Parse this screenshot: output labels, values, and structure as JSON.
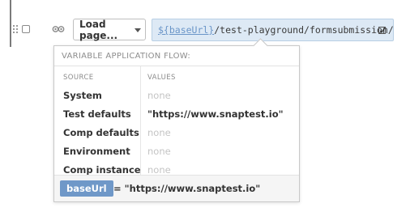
{
  "step": {
    "action_label": "Load page...",
    "url_variable": "${baseUrl}",
    "url_path": "/test-playground/formsubmission/"
  },
  "popover": {
    "title": "VARIABLE APPLICATION FLOW:",
    "columns": {
      "source": "SOURCE",
      "values": "VALUES"
    },
    "rows": [
      {
        "source": "System",
        "value": "none",
        "set": false
      },
      {
        "source": "Test defaults",
        "value": "\"https://www.snaptest.io\"",
        "set": true
      },
      {
        "source": "Comp defaults",
        "value": "none",
        "set": false
      },
      {
        "source": "Environment",
        "value": "none",
        "set": false
      },
      {
        "source": "Comp instance",
        "value": "none",
        "set": false
      }
    ],
    "footer": {
      "variable_name": "baseUrl",
      "resolved_value": "= \"https://www.snaptest.io\""
    }
  },
  "colors": {
    "url_field_bg": "#dde9f5",
    "variable_chip": "#6f98c8",
    "variable_link": "#6a95c8",
    "empty_value": "#c4c4c4"
  },
  "icons": [
    "drag-handle-icon",
    "checkbox-icon",
    "eye-icon",
    "chevron-down-icon",
    "edit-icon"
  ]
}
